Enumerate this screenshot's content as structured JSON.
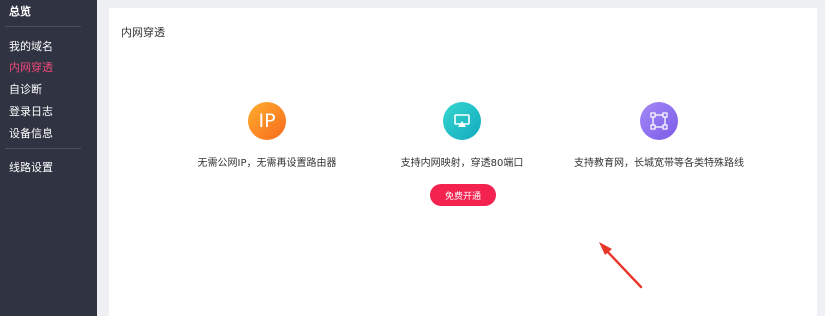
{
  "sidebar": {
    "items": [
      {
        "label": "总览"
      },
      {
        "label": "我的域名"
      },
      {
        "label": "内网穿透"
      },
      {
        "label": "自诊断"
      },
      {
        "label": "登录日志"
      },
      {
        "label": "设备信息"
      },
      {
        "label": "线路设置"
      }
    ],
    "active_index": 2
  },
  "main": {
    "title": "内网穿透",
    "features": [
      {
        "icon": "ip-icon",
        "icon_text": "IP",
        "text": "无需公网IP，无需再设置路由器"
      },
      {
        "icon": "screen-cast-icon",
        "text": "支持内网映射，穿透80端口"
      },
      {
        "icon": "bounding-box-icon",
        "text": "支持教育网，长城宽带等各类特殊路线"
      }
    ],
    "button_label": "免费开通"
  },
  "colors": {
    "sidebar_bg": "#2f3342",
    "accent": "#f0487a",
    "button": "#f3224f",
    "arrow": "#e8362a"
  }
}
